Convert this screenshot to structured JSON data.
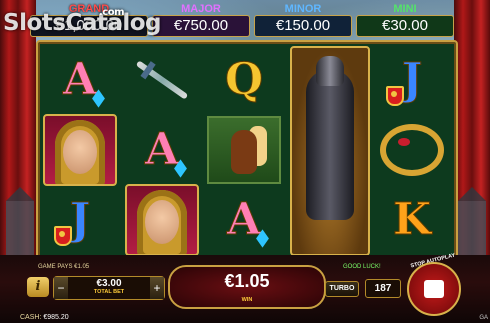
{
  "watermark": {
    "text": "SlotsCatalog",
    "dotcom": ".com"
  },
  "jackpots": {
    "grand": {
      "label": "GRAND",
      "value": "€1,000.00"
    },
    "major": {
      "label": "MAJOR",
      "value": "€750.00"
    },
    "minor": {
      "label": "MINOR",
      "value": "€150.00"
    },
    "mini": {
      "label": "MINI",
      "value": "€30.00"
    }
  },
  "reels": {
    "r1": [
      "A",
      "lady-portrait",
      "J"
    ],
    "r2": [
      "sword",
      "A",
      "lady-portrait"
    ],
    "r3": [
      "Q",
      "horse",
      "A"
    ],
    "r4": [
      "knight-expanded"
    ],
    "r5": [
      "J",
      "crown",
      "K"
    ]
  },
  "labels": {
    "A": "A",
    "Q": "Q",
    "J": "J",
    "K": "K"
  },
  "footer": {
    "game_pays": "GAME PAYS €1.05",
    "good_luck": "GOOD LUCK!",
    "info": "i",
    "bet_minus": "−",
    "bet_plus": "+",
    "bet_amount": "€3.00",
    "bet_caption": "TOTAL BET",
    "win_amount": "€1.05",
    "win_caption": "WIN",
    "turbo": "TURBO",
    "autoplay_count": "187",
    "spin_caption": "STOP AUTOPLAY",
    "cash_label": "CASH:",
    "cash_value": "€985.20",
    "corner": "GA"
  },
  "colors": {
    "grand": "#ff4b4b",
    "major": "#e070ff",
    "minor": "#5fb6ff",
    "mini": "#54e36a",
    "frame_gold": "#c9a142",
    "curtain_red": "#b01818"
  }
}
